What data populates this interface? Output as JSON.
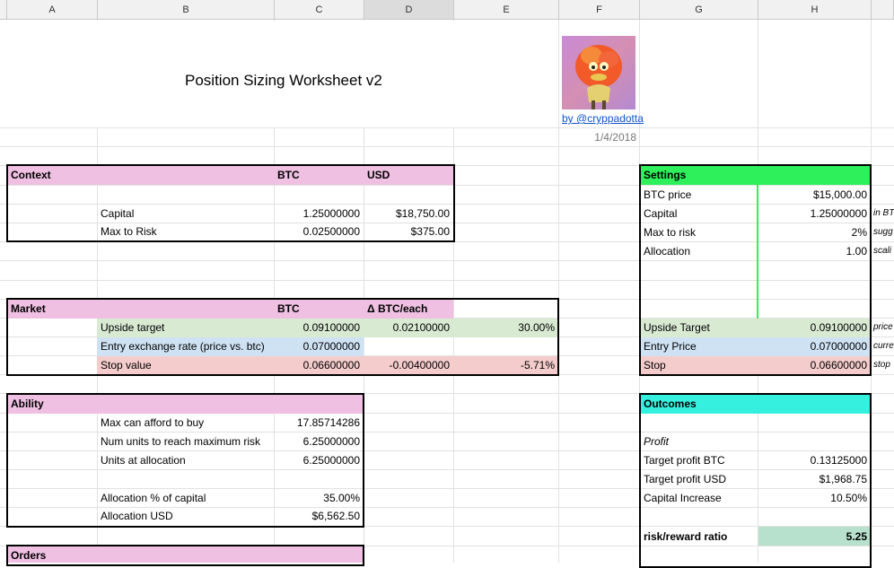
{
  "columns": [
    "A",
    "B",
    "C",
    "D",
    "E",
    "F",
    "G",
    "H"
  ],
  "title": "Position Sizing Worksheet v2",
  "author_link": "by @cryppadotta",
  "date": "1/4/2018",
  "colors": {
    "header_pink": "#efc0e2",
    "settings_green": "#2df05a",
    "outcomes_teal": "#35f0de",
    "light_green": "#d9ead3",
    "light_blue": "#cfe2f3",
    "light_red": "#f4cccc",
    "ratio_green": "#b7e1cd"
  },
  "context": {
    "header": "Context",
    "col_btc": "BTC",
    "col_usd": "USD",
    "capital_label": "Capital",
    "capital_btc": "1.25000000",
    "capital_usd": "$18,750.00",
    "risk_label": "Max to Risk",
    "risk_btc": "0.02500000",
    "risk_usd": "$375.00"
  },
  "market": {
    "header": "Market",
    "col_btc": "BTC",
    "col_delta": "Δ BTC/each",
    "upside_label": "Upside target",
    "upside_btc": "0.09100000",
    "upside_delta": "0.02100000",
    "upside_pct": "30.00%",
    "entry_label": "Entry exchange rate (price vs. btc)",
    "entry_btc": "0.07000000",
    "stop_label": "Stop value",
    "stop_btc": "0.06600000",
    "stop_delta": "-0.00400000",
    "stop_pct": "-5.71%"
  },
  "ability": {
    "header": "Ability",
    "afford_label": "Max can afford to buy",
    "afford_val": "17.85714286",
    "units_risk_label": "Num units to reach maximum risk",
    "units_risk_val": "6.25000000",
    "units_alloc_label": "Units at allocation",
    "units_alloc_val": "6.25000000",
    "alloc_pct_label": "Allocation % of capital",
    "alloc_pct_val": "35.00%",
    "alloc_usd_label": "Allocation USD",
    "alloc_usd_val": "$6,562.50"
  },
  "orders": {
    "header": "Orders"
  },
  "settings": {
    "header": "Settings",
    "btc_price_label": "BTC price",
    "btc_price_val": "$15,000.00",
    "capital_label": "Capital",
    "capital_val": "1.25000000",
    "capital_note": "in BT",
    "risk_label": "Max to risk",
    "risk_val": "2%",
    "risk_note": "sugg",
    "alloc_label": "Allocation",
    "alloc_val": "1.00",
    "alloc_note": "scali",
    "upside_label": "Upside Target",
    "upside_val": "0.09100000",
    "upside_note": "price",
    "entry_label": "Entry Price",
    "entry_val": "0.07000000",
    "entry_note": "curre",
    "stop_label": "Stop",
    "stop_val": "0.06600000",
    "stop_note": "stop"
  },
  "outcomes": {
    "header": "Outcomes",
    "profit_label": "Profit",
    "target_btc_label": "Target profit BTC",
    "target_btc_val": "0.13125000",
    "target_usd_label": "Target profit USD",
    "target_usd_val": "$1,968.75",
    "cap_inc_label": "Capital Increase",
    "cap_inc_val": "10.50%",
    "ratio_label": "risk/reward ratio",
    "ratio_val": "5.25"
  }
}
